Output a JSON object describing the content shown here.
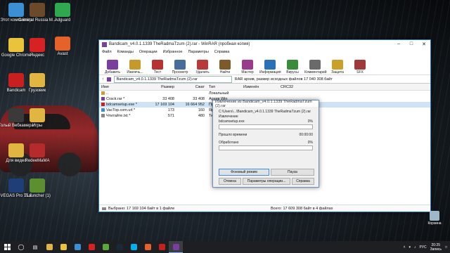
{
  "desktop": {
    "icons_left": [
      {
        "label": "Этот компьютер",
        "color": "#3d8fd4"
      },
      {
        "label": "Google Chrome",
        "color": "#e9c33b"
      },
      {
        "label": "Bandicam",
        "color": "#c82020"
      },
      {
        "label": "Голый Вебкамера",
        "color": "#3a3a3a"
      },
      {
        "label": "Для видео",
        "color": "#e0b542"
      },
      {
        "label": "VEGAS Pro 15.0",
        "color": "#1f3e78"
      }
    ],
    "icons_col2": [
      {
        "label": "Criminal Russia M...",
        "color": "#6a4a2a"
      },
      {
        "label": "Яндекс",
        "color": "#d62222"
      },
      {
        "label": "Грузовик",
        "color": "#e0b542"
      },
      {
        "label": "Игры",
        "color": "#e0b542"
      },
      {
        "label": "RedeeMaMA",
        "color": "#b52a2a"
      },
      {
        "label": "TLauncher (1)",
        "color": "#5c8f2f"
      }
    ],
    "icons_col3": [
      {
        "label": "Adguard",
        "color": "#2fa84f"
      },
      {
        "label": "Avast",
        "color": "#e5622a"
      }
    ],
    "recycle_bin": {
      "label": "Корзина"
    }
  },
  "winrar": {
    "title": "Bandicam_v4.0.1.1339 TheRadmaTzum (2).rar - WinRAR (пробная копия)",
    "menu": [
      "Файл",
      "Команды",
      "Операции",
      "Избранное",
      "Параметры",
      "Справка"
    ],
    "toolbar": [
      {
        "label": "Добавить",
        "color": "#7a3f9c"
      },
      {
        "label": "Извлечь...",
        "color": "#c59a2a"
      },
      {
        "label": "Тест",
        "color": "#b93232"
      },
      {
        "label": "Просмотр",
        "color": "#4a6c9a"
      },
      {
        "label": "Удалить",
        "color": "#b83a3a"
      },
      {
        "label": "Найти",
        "color": "#7d5a2a"
      },
      {
        "label": "Мастер",
        "color": "#9a3a8c"
      },
      {
        "label": "Информация",
        "color": "#2a72b8"
      },
      {
        "label": "Вирусы",
        "color": "#3a8c3a"
      },
      {
        "label": "Комментарий",
        "color": "#6a6a6a"
      },
      {
        "label": "Защита",
        "color": "#c8a02a"
      },
      {
        "label": "SFX",
        "color": "#a03a3a"
      }
    ],
    "path": "Bandicam_v4.0.1.1339 TheRadmaTzum (2).rar",
    "path_info": "RAR архив, размер исходных файлов 17 040 308 байт",
    "columns": [
      "Имя",
      "Размер",
      "Сжат",
      "Тип",
      "Изменён",
      "CRC32"
    ],
    "files": [
      {
        "name": "..",
        "size": "",
        "packed": "",
        "type": "Локальный",
        "icon": "#c8a02a"
      },
      {
        "name": "Crack.rar *",
        "size": "33 408",
        "packed": "33 408",
        "type": "Архив Win",
        "icon": "#7a3f9c"
      },
      {
        "name": "bdcamsetup.exe *",
        "size": "17 169 104",
        "packed": "16 664 952",
        "type": "Приложение",
        "icon": "#c82020"
      },
      {
        "name": "VacTop.com.url *",
        "size": "173",
        "packed": "160",
        "type": "Ярлык Инт",
        "icon": "#3d8fd4"
      },
      {
        "name": "Чтитайте.txt *",
        "size": "571",
        "packed": "480",
        "type": "Текстовый",
        "icon": "#888888"
      }
    ],
    "selected_index": 2,
    "status_left": "Выбрано: 17 169 104 байт в 1 файле",
    "status_right": "Всего: 17 609 308 байт в 4 файлах"
  },
  "extract_dialog": {
    "title": "Извлечение из Bandicam_v4.0.1.1339 TheRadmaTzum (2).rar",
    "archive_path": "C:\\Users\\...\\Bandicam_v4.0.1.1339 TheRadmaTzum (2).rar",
    "action": "Извлечение",
    "current_file": "bdcamsetup.exe",
    "percent_file": "0%",
    "elapsed_label": "Прошло времени",
    "elapsed_value": "00:00:00",
    "processed_label": "Обработано",
    "percent_total": "0%",
    "progress_file": 0,
    "progress_total": 0,
    "buttons": {
      "background": "Фоновый режим",
      "pause": "Пауза",
      "cancel": "Отмена",
      "mode": "Режим",
      "params": "Параметры операции...",
      "help": "Справка"
    }
  },
  "taskbar": {
    "apps": [
      {
        "name": "explorer",
        "color": "#e0b542"
      },
      {
        "name": "chrome",
        "color": "#e9c33b"
      },
      {
        "name": "store",
        "color": "#3d8fd4"
      },
      {
        "name": "yandex",
        "color": "#d62222"
      },
      {
        "name": "utorrent",
        "color": "#5aa83c"
      },
      {
        "name": "steam",
        "color": "#1b2838"
      },
      {
        "name": "skype",
        "color": "#00aff0"
      },
      {
        "name": "vlc",
        "color": "#e5622a"
      },
      {
        "name": "record",
        "color": "#c82020"
      },
      {
        "name": "winrar",
        "color": "#7a3f9c"
      }
    ],
    "lang": "РУС",
    "time": "20:25",
    "date": "Запись"
  }
}
